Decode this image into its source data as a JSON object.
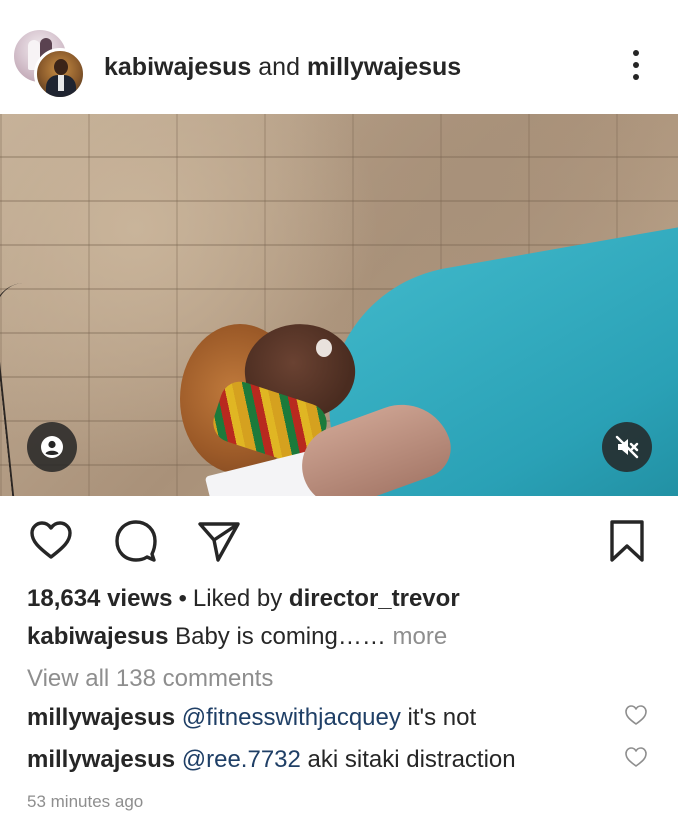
{
  "header": {
    "user1": "kabiwajesus",
    "conjunction": "and",
    "user2": "millywajesus"
  },
  "media": {
    "user_tag_icon": "person-icon",
    "mute_icon": "volume-muted-icon"
  },
  "actions": {
    "like_icon": "heart-icon",
    "comment_icon": "speech-bubble-icon",
    "share_icon": "paper-plane-icon",
    "save_icon": "bookmark-icon"
  },
  "stats": {
    "views": "18,634 views",
    "separator": "•",
    "liked_by_prefix": "Liked by",
    "liked_by_user": "director_trevor"
  },
  "caption": {
    "user": "kabiwajesus",
    "text": "Baby is coming…… ",
    "more": "more"
  },
  "view_all_comments": "View all 138 comments",
  "comments": [
    {
      "user": "millywajesus",
      "mention": "@fitnesswithjacquey",
      "text": " it's not"
    },
    {
      "user": "millywajesus",
      "mention": "@ree.7732",
      "text": " aki sitaki distraction"
    }
  ],
  "timestamp": "53 minutes ago",
  "colors": {
    "text": "#262626",
    "muted": "#8e8e8e",
    "mention": "#1f3f66",
    "shirt": "#2aa1b6"
  }
}
